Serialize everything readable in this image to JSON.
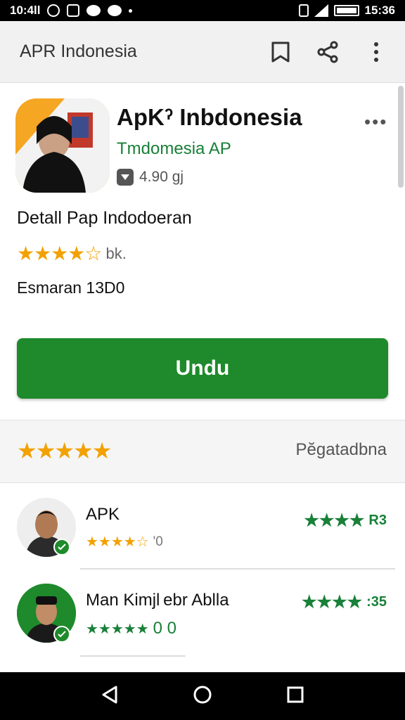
{
  "status_bar": {
    "left_text": "10:4ll",
    "time": "15:36"
  },
  "app_bar": {
    "title": "APR Indonesia"
  },
  "app": {
    "name": "ApKˀ Inbdonesia",
    "developer": "Tmdomesia AP",
    "meta_text": "4.90 gj"
  },
  "details": {
    "title": "Detall Pap Indodoeran",
    "stars": "★★★★☆",
    "rating": 4.5,
    "rating_suffix": "bk.",
    "size": "Esmaran 13D0"
  },
  "install_label": "Undu",
  "summary": {
    "stars": "★★★★★",
    "link": "Pĕgatadbna"
  },
  "reviews": [
    {
      "name": "APK",
      "stars": "★★★★☆",
      "sub_text": "'0",
      "right_stars": "★★★★",
      "right_text": "R3"
    },
    {
      "name": "Man Kimjl ebr Ablla",
      "stars": "★★★★★",
      "sub_text": "0 0",
      "right_stars": "★★★★",
      "right_text": ":35"
    }
  ],
  "colors": {
    "accent_green": "#1e8a2b",
    "star_orange": "#f2a100",
    "dev_green": "#188038"
  }
}
